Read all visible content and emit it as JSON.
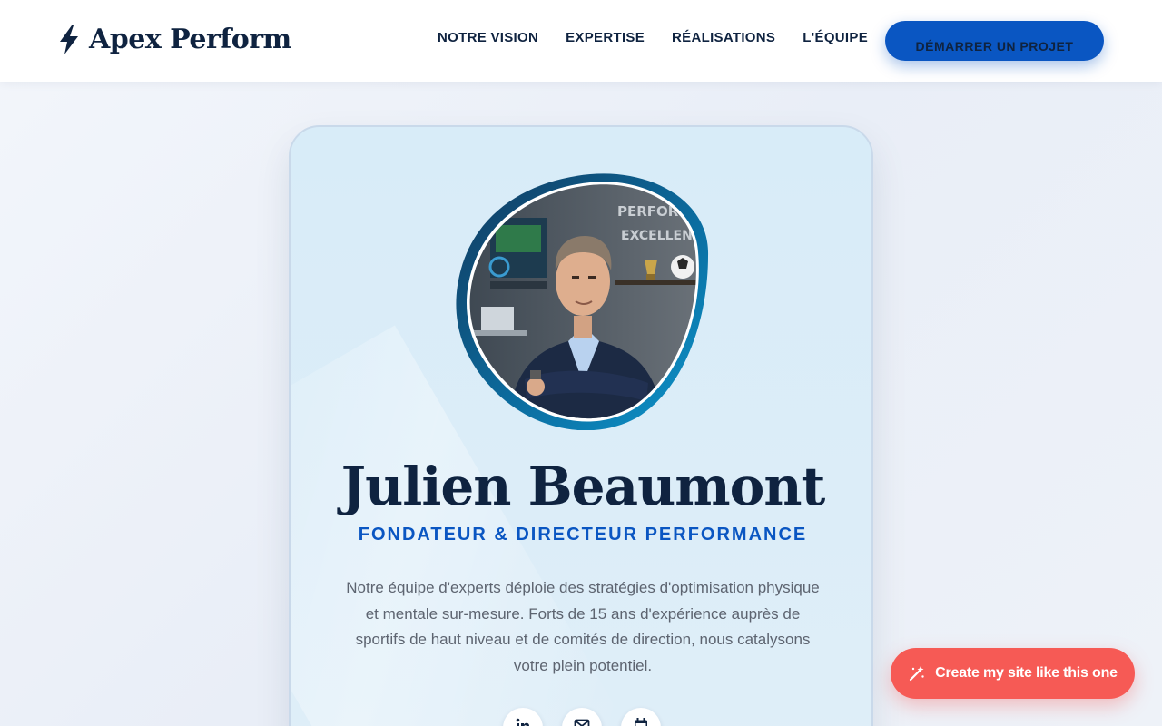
{
  "brand": {
    "name": "Apex Perform",
    "icon": "lightning-bolt-icon"
  },
  "nav": {
    "items": [
      {
        "label": "NOTRE VISION"
      },
      {
        "label": "EXPERTISE"
      },
      {
        "label": "RÉALISATIONS"
      },
      {
        "label": "L'ÉQUIPE"
      }
    ],
    "cta_label": "DÉMARRER UN PROJET"
  },
  "profile": {
    "name": "Julien Beaumont",
    "role": "FONDATEUR & DIRECTEUR PERFORMANCE",
    "bio": "Notre équipe d'experts déploie des stratégies d'optimisation physique et mentale sur-mesure. Forts de 15 ans d'expérience auprès de sportifs de haut niveau et de comités de direction, nous catalysons votre plein potentiel.",
    "portrait_signage": [
      "PERFORM",
      "EXCELLENCE"
    ],
    "socials": [
      {
        "icon": "linkedin-icon"
      },
      {
        "icon": "mail-icon"
      },
      {
        "icon": "calendar-icon"
      }
    ]
  },
  "floating_cta": {
    "label": "Create my site like this one",
    "icon": "magic-wand-icon"
  },
  "colors": {
    "navy": "#0f2340",
    "accent_blue": "#0a56c2",
    "coral": "#f65a55",
    "card_bg": "#d8ecf8"
  }
}
